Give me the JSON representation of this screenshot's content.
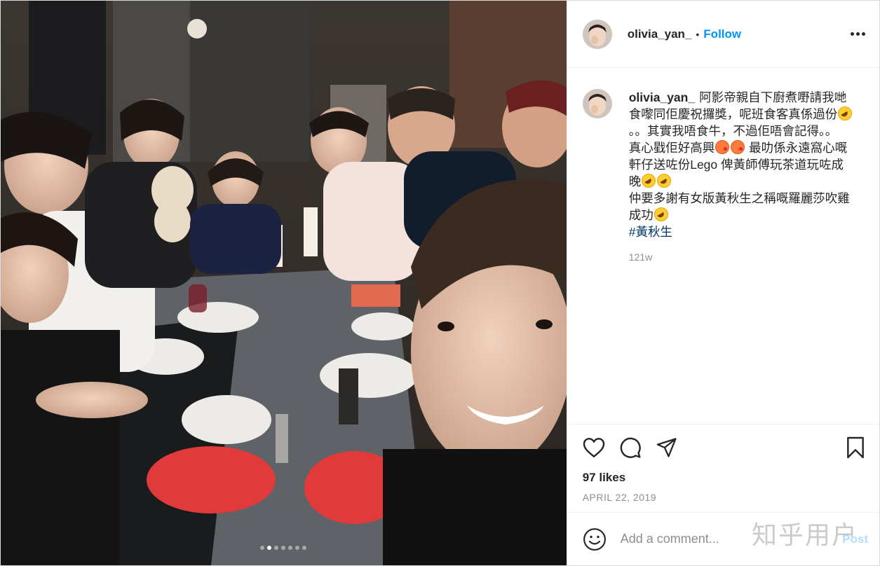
{
  "post": {
    "username": "olivia_yan_",
    "follow_label": "Follow",
    "separator": "•",
    "caption_parts": [
      "阿影帝親自下廚煮嘢請我哋食嚟同佢慶祝攞獎，呢班食客真係過份",
      "。。其實我唔食牛，不過佢唔會記得。。",
      "真心戥佢好高興",
      "最叻係永遠窩心嘅軒仔送咗份Lego 俾黃師傅玩茶道玩咗成晚",
      "仲要多謝有女版黃秋生之稱嘅羅麗莎吹雞成功"
    ],
    "hashtag": "#黃秋生",
    "comment_time": "121w",
    "likes": "97 likes",
    "date": "APRIL 22, 2019",
    "comment_placeholder": "Add a comment...",
    "post_label": "Post",
    "watermark": "知乎用户"
  },
  "icons": {
    "more": "more-options-icon",
    "like": "heart-icon",
    "comment": "comment-icon",
    "share": "paper-plane-icon",
    "save": "bookmark-icon",
    "emoji": "smiley-icon"
  },
  "carousel": {
    "count": 7,
    "active": 1
  },
  "colors": {
    "link": "#0095f6",
    "hashtag": "#00376b",
    "muted": "#8e8e8e",
    "plate_red": "#e03a3a"
  }
}
